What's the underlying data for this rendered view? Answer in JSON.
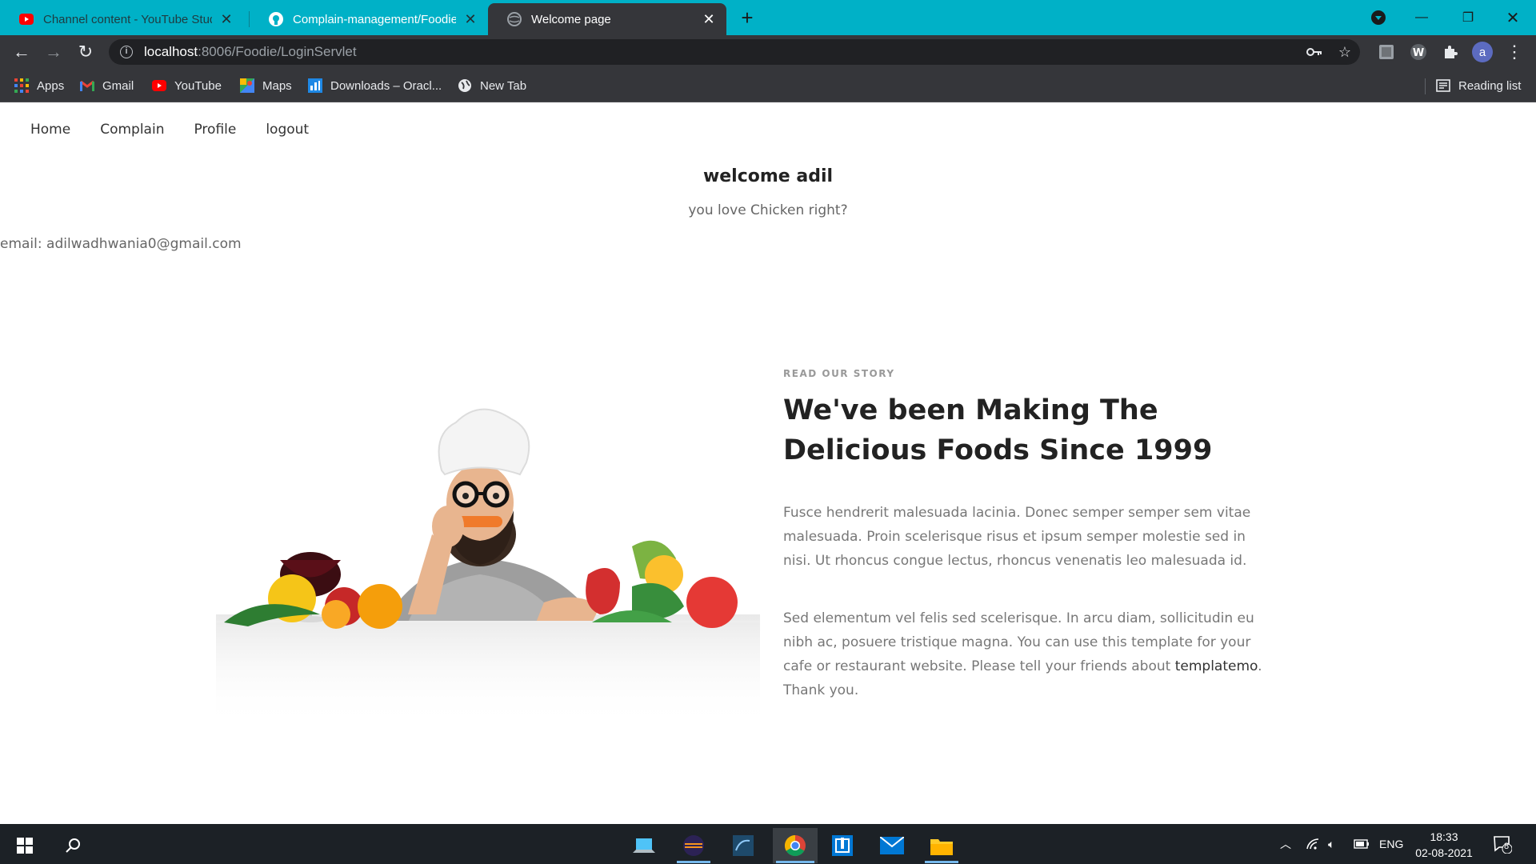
{
  "browser": {
    "tabs": [
      {
        "title": "Channel content - YouTube Studio",
        "favicon": "youtube-icon",
        "active": false
      },
      {
        "title": "Complain-management/Foodie at main",
        "favicon": "github-icon",
        "active": false
      },
      {
        "title": "Welcome page",
        "favicon": "globe-icon",
        "active": true
      }
    ],
    "url_host": "localhost",
    "url_rest": ":8006/Foodie/LoginServlet",
    "profile_initial": "a",
    "bookmarks": [
      {
        "label": "Apps",
        "icon": "apps-grid-icon"
      },
      {
        "label": "Gmail",
        "icon": "gmail-icon"
      },
      {
        "label": "YouTube",
        "icon": "youtube-icon"
      },
      {
        "label": "Maps",
        "icon": "maps-icon"
      },
      {
        "label": "Downloads – Oracl...",
        "icon": "oracle-icon"
      },
      {
        "label": "New Tab",
        "icon": "globe-icon"
      }
    ],
    "reading_list": "Reading list",
    "accent_color": "#00b1c7"
  },
  "page": {
    "nav": [
      "Home",
      "Complain",
      "Profile",
      "logout"
    ],
    "welcome": "welcome adil",
    "tagline": "you love Chicken right?",
    "email_label": "email:",
    "email_value": "adilwadhwania0@gmail.com",
    "story": {
      "kicker": "READ OUR STORY",
      "title": "We've been Making The Delicious Foods Since 1999",
      "p1": "Fusce hendrerit malesuada lacinia. Donec semper semper sem vitae malesuada. Proin scelerisque risus et ipsum semper molestie sed in nisi. Ut rhoncus congue lectus, rhoncus venenatis leo malesuada id.",
      "p2_before": "Sed elementum vel felis sed scelerisque. In arcu diam, sollicitudin eu nibh ac, posuere tristique magna. You can use this template for your cafe or restaurant website. Please tell your friends about ",
      "p2_link": "templatemo",
      "p2_after": ". Thank you."
    }
  },
  "taskbar": {
    "language": "ENG",
    "time": "18:33",
    "date": "02-08-2021",
    "notification_count": "8"
  }
}
